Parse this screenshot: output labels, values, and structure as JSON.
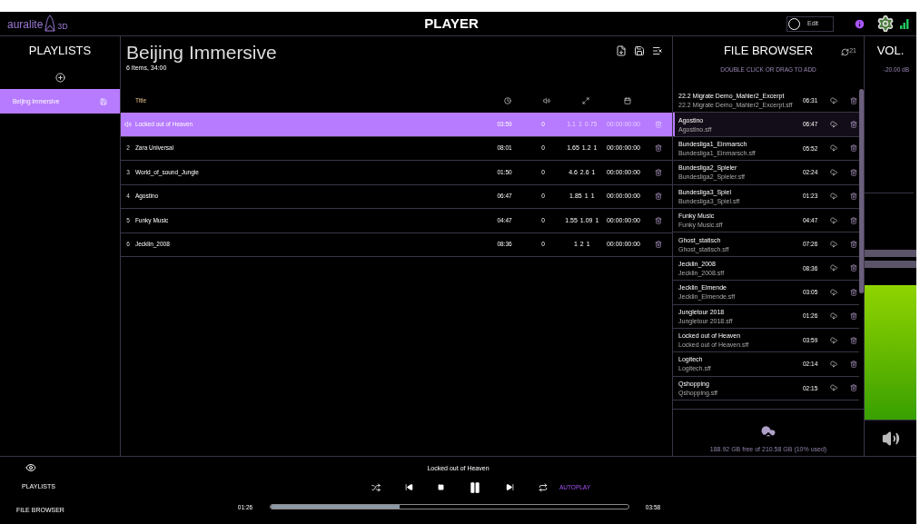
{
  "header": {
    "logo": "auralite",
    "logo_suffix": "3D",
    "title": "PLAYER",
    "edit_toggle": {
      "label": "Edit",
      "on": false
    }
  },
  "playlists": {
    "title": "PLAYLISTS",
    "items": [
      {
        "name": "Beijing Immersive",
        "selected": true
      }
    ]
  },
  "playlist": {
    "title": "Beijing Immersive",
    "summary": "6 Items, 34:00",
    "columns": [
      "Title"
    ],
    "rows": [
      {
        "number": "",
        "title": "Locked out of Heaven",
        "duration": "03:59",
        "volume": "0",
        "scale": [
          "1.1",
          "1",
          "0.75"
        ],
        "timecode": "00:00:00:00",
        "playing": true,
        "selected": true
      },
      {
        "number": "2",
        "title": "Zara Universal",
        "duration": "08:01",
        "volume": "0",
        "scale": [
          "1.65",
          "1.2",
          "1"
        ],
        "timecode": "00:00:00:00",
        "playing": false,
        "selected": false
      },
      {
        "number": "3",
        "title": "World_of_sound_Jungle",
        "duration": "01:50",
        "volume": "0",
        "scale": [
          "4.6",
          "2.6",
          "1"
        ],
        "timecode": "00:00:00:00",
        "playing": false,
        "selected": false
      },
      {
        "number": "4",
        "title": "Agostino",
        "duration": "06:47",
        "volume": "0",
        "scale": [
          "1.85",
          "1",
          "1"
        ],
        "timecode": "00:00:00:00",
        "playing": false,
        "selected": false
      },
      {
        "number": "5",
        "title": "Funky Music",
        "duration": "04:47",
        "volume": "0",
        "scale": [
          "1.55",
          "1.09",
          "1"
        ],
        "timecode": "00:00:00:00",
        "playing": false,
        "selected": false
      },
      {
        "number": "6",
        "title": "Jecklin_2008",
        "duration": "08:36",
        "volume": "0",
        "scale": [
          "1",
          "2",
          "1"
        ],
        "timecode": "00:00:00:00",
        "playing": false,
        "selected": false
      }
    ]
  },
  "file_browser": {
    "title": "FILE BROWSER",
    "refresh_badge": "21",
    "hint": "DOUBLE CLICK OR DRAG TO ADD",
    "storage": "188.92 GB free of 210.58 GB (10% used)",
    "files": [
      {
        "name": "22.2 Migrate Demo_Mahler2_Excerpt",
        "file": "22.2 Migrate Demo_Mahler2_Excerpt.sff",
        "duration": "06:31",
        "selected": false
      },
      {
        "name": "Agostino",
        "file": "Agostino.sff",
        "duration": "06:47",
        "selected": true
      },
      {
        "name": "Bundesliga1_Einmarsch",
        "file": "Bundesliga1_Einmarsch.sff",
        "duration": "05:52",
        "selected": false
      },
      {
        "name": "Bundesliga2_Spieler",
        "file": "Bundesliga2_Spieler.sff",
        "duration": "02:24",
        "selected": false
      },
      {
        "name": "Bundesliga3_Spiel",
        "file": "Bundesliga3_Spiel.sff",
        "duration": "01:23",
        "selected": false
      },
      {
        "name": "Funky Music",
        "file": "Funky Music.sff",
        "duration": "04:47",
        "selected": false
      },
      {
        "name": "Ghost_statisch",
        "file": "Ghost_statisch.sff",
        "duration": "07:26",
        "selected": false
      },
      {
        "name": "Jecklin_2008",
        "file": "Jecklin_2008.sff",
        "duration": "08:36",
        "selected": false
      },
      {
        "name": "Jecklin_Elmende",
        "file": "Jecklin_Elmende.sff",
        "duration": "03:05",
        "selected": false
      },
      {
        "name": "Jungletour 2018",
        "file": "Jungletour 2018.sff",
        "duration": "01:26",
        "selected": false
      },
      {
        "name": "Locked out of Heaven",
        "file": "Locked out of Heaven.sff",
        "duration": "03:59",
        "selected": false
      },
      {
        "name": "Logitech",
        "file": "Logitech.sff",
        "duration": "02:14",
        "selected": false
      },
      {
        "name": "Qshopping",
        "file": "Qshopping.sff",
        "duration": "02:15",
        "selected": false
      }
    ]
  },
  "volume": {
    "title": "VOL.",
    "reading": "-20.00 dB",
    "level": 0.4
  },
  "player": {
    "now_playing": "Locked out of Heaven",
    "autoplay": {
      "label": "AUTOPLAY",
      "on": true
    },
    "elapsed": "01:26",
    "total": "03:58",
    "level": 0.36,
    "paused": false,
    "view_labels": [
      "PLAYLISTS",
      "FILE BROWSER"
    ]
  }
}
